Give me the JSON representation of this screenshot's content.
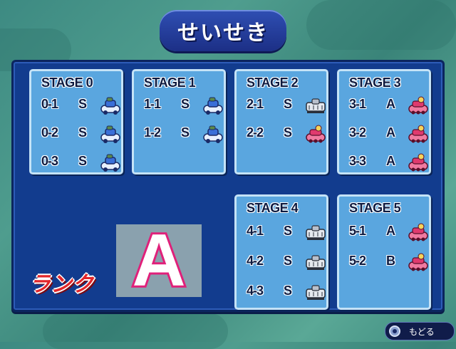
{
  "title": "せいせき",
  "rank_label": "ランク",
  "overall_rank": "A",
  "back_button": {
    "label": "もどる",
    "icon": "circle-button-icon"
  },
  "stages": [
    {
      "title": "STAGE 0",
      "rows": [
        {
          "stage": "0-1",
          "rank": "S",
          "tank": "blue-tank"
        },
        {
          "stage": "0-2",
          "rank": "S",
          "tank": "blue-tank"
        },
        {
          "stage": "0-3",
          "rank": "S",
          "tank": "blue-tank"
        }
      ]
    },
    {
      "title": "STAGE 1",
      "rows": [
        {
          "stage": "1-1",
          "rank": "S",
          "tank": "blue-tank"
        },
        {
          "stage": "1-2",
          "rank": "S",
          "tank": "blue-tank"
        }
      ]
    },
    {
      "title": "STAGE 2",
      "rows": [
        {
          "stage": "2-1",
          "rank": "S",
          "tank": "gray-tank"
        },
        {
          "stage": "2-2",
          "rank": "S",
          "tank": "pink-tank"
        }
      ]
    },
    {
      "title": "STAGE 3",
      "rows": [
        {
          "stage": "3-1",
          "rank": "A",
          "tank": "pink-tank"
        },
        {
          "stage": "3-2",
          "rank": "A",
          "tank": "pink-tank"
        },
        {
          "stage": "3-3",
          "rank": "A",
          "tank": "pink-tank"
        }
      ]
    },
    {
      "title": "STAGE 4",
      "rows": [
        {
          "stage": "4-1",
          "rank": "S",
          "tank": "gray-tank"
        },
        {
          "stage": "4-2",
          "rank": "S",
          "tank": "gray-tank"
        },
        {
          "stage": "4-3",
          "rank": "S",
          "tank": "gray-tank"
        }
      ]
    },
    {
      "title": "STAGE 5",
      "rows": [
        {
          "stage": "5-1",
          "rank": "A",
          "tank": "pink-tank"
        },
        {
          "stage": "5-2",
          "rank": "B",
          "tank": "pink-tank"
        }
      ]
    }
  ],
  "colors": {
    "board": "#123c8e",
    "panel": "#5aa6df",
    "rank_stroke": "#e0207a",
    "rank_label": "#e2262a"
  }
}
